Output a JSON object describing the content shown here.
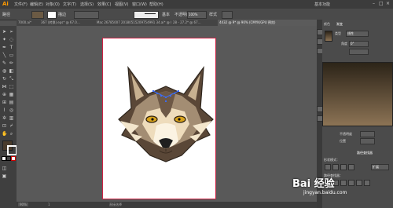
{
  "menubar": {
    "logo": "Ai",
    "items": [
      "文件(F)",
      "编辑(E)",
      "对象(O)",
      "文字(T)",
      "选择(S)",
      "效果(C)",
      "视图(V)",
      "窗口(W)",
      "帮助(H)"
    ],
    "workspace": "基本功能"
  },
  "control_bar": {
    "label": "路径",
    "stroke_label": "描边",
    "stroke_style": "基本",
    "opacity_label": "不透明度",
    "opacity_value": "100%",
    "style_label": "样式"
  },
  "document_tabs": [
    "7000.ai*",
    "367 (转换).eps* @ 67.0…",
    "Mac 26785007 20180515209754991 34.ai* @ 81.…",
    "28 - 27.2* @ 67…",
    "4432 @ 9* @ 90% (CMYK/GPU 预览)"
  ],
  "status_bar": {
    "zoom": "90%",
    "page": "1",
    "mode": "直接选择"
  },
  "panels": {
    "color_tab": "颜色",
    "gradient_tab": "渐变",
    "type_label": "类型",
    "type_value": "线性",
    "angle_label": "角度",
    "angle_value": "0°",
    "opacity_label": "不透明度",
    "location_label": "位置",
    "pathfinder_tab": "路径查找器",
    "shape_modes_label": "形状模式：",
    "pathfinders_label": "路径查找器：",
    "expand_button": "扩展"
  },
  "artwork": {
    "subject": "wolf-head",
    "colors": {
      "fur_dark": "#5a4737",
      "fur_mid": "#a38d73",
      "fur_light": "#eedcbc",
      "muzzle": "#fbf3e2",
      "eye": "#d8a31c",
      "nose": "#1f1f1f",
      "selection": "#3b6dff"
    }
  },
  "gradient_preview": {
    "color_start": "#2c2418",
    "color_end": "#8c7355"
  },
  "watermark": {
    "text": "Bai 经验",
    "url": "jingyan.baidu.com"
  },
  "theme": {
    "accent": "#ff9a00",
    "artboard_border": "#c2244a"
  }
}
